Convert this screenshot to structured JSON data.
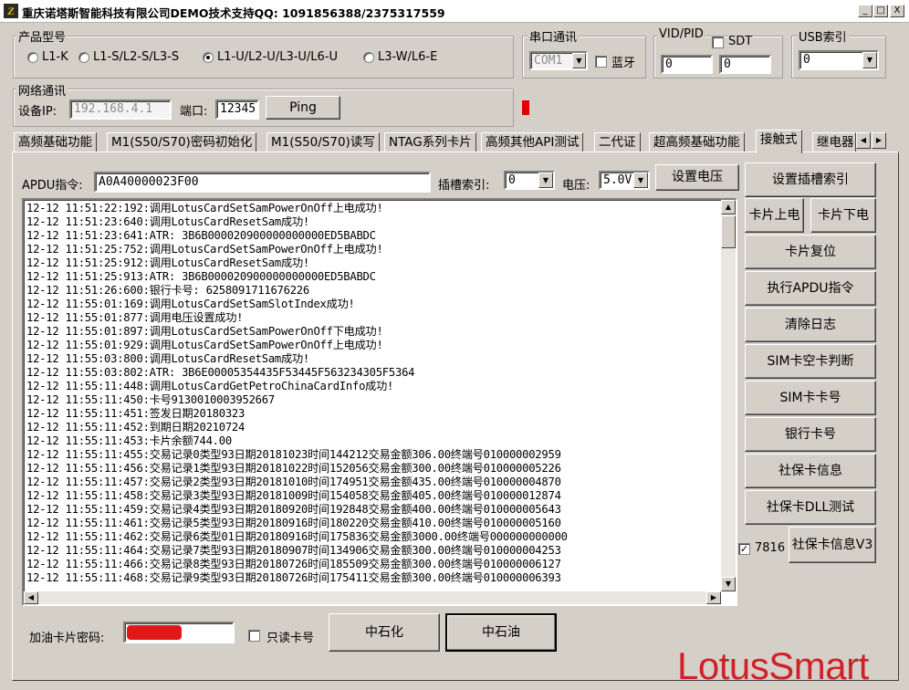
{
  "window": {
    "title": "重庆诺塔斯智能科技有限公司DEMO技术支持QQ: 1091856388/2375317559",
    "min": "_",
    "max": "□",
    "close": "X"
  },
  "product": {
    "group_label": "产品型号",
    "options": [
      "L1-K",
      "L1-S/L2-S/L3-S",
      "L1-U/L2-U/L3-U/L6-U",
      "L3-W/L6-E"
    ],
    "selected_index": 2
  },
  "serial": {
    "group_label": "串口通讯",
    "port": "COM1",
    "bluetooth_label": "蓝牙"
  },
  "vidpid": {
    "group_label": "VID/PID",
    "sdt_label": "SDT",
    "vid": "0",
    "pid": "0"
  },
  "usb": {
    "group_label": "USB索引",
    "value": "0"
  },
  "network": {
    "group_label": "网络通讯",
    "ip_label": "设备IP:",
    "ip": "192.168.4.1",
    "port_label": "端口:",
    "port": "12345",
    "ping_label": "Ping"
  },
  "tabs": [
    "高频基础功能",
    "M1(S50/S70)密码初始化",
    "M1(S50/S70)读写",
    "NTAG系列卡片",
    "高频其他API测试",
    "二代证",
    "超高频基础功能",
    "接触式",
    "继电器"
  ],
  "active_tab": "接触式",
  "apdu": {
    "label": "APDU指令:",
    "value": "A0A40000023F00",
    "slot_label": "插槽索引:",
    "slot": "0",
    "voltage_label": "电压:",
    "voltage": "5.0V",
    "set_voltage": "设置电压"
  },
  "log": [
    "12-12 11:51:22:192:调用LotusCardSetSamPowerOnOff上电成功!",
    "12-12 11:51:23:640:调用LotusCardResetSam成功!",
    "12-12 11:51:23:641:ATR: 3B6B000020900000000000ED5BABDC",
    "12-12 11:51:25:752:调用LotusCardSetSamPowerOnOff上电成功!",
    "12-12 11:51:25:912:调用LotusCardResetSam成功!",
    "12-12 11:51:25:913:ATR: 3B6B000020900000000000ED5BABDC",
    "12-12 11:51:26:600:银行卡号: 6258091711676226",
    "12-12 11:55:01:169:调用LotusCardSetSamSlotIndex成功!",
    "12-12 11:55:01:877:调用电压设置成功!",
    "12-12 11:55:01:897:调用LotusCardSetSamPowerOnOff下电成功!",
    "12-12 11:55:01:929:调用LotusCardSetSamPowerOnOff上电成功!",
    "12-12 11:55:03:800:调用LotusCardResetSam成功!",
    "12-12 11:55:03:802:ATR: 3B6E00005354435F53445F563234305F5364",
    "12-12 11:55:11:448:调用LotusCardGetPetroChinaCardInfo成功!",
    "12-12 11:55:11:450:卡号9130010003952667",
    "12-12 11:55:11:451:签发日期20180323",
    "12-12 11:55:11:452:到期日期20210724",
    "12-12 11:55:11:453:卡片余额744.00",
    "12-12 11:55:11:455:交易记录0类型93日期20181023时间144212交易金额306.00终端号010000002959",
    "12-12 11:55:11:456:交易记录1类型93日期20181022时间152056交易金额300.00终端号010000005226",
    "12-12 11:55:11:457:交易记录2类型93日期20181010时间174951交易金额435.00终端号010000004870",
    "12-12 11:55:11:458:交易记录3类型93日期20181009时间154058交易金额405.00终端号010000012874",
    "12-12 11:55:11:459:交易记录4类型93日期20180920时间192848交易金额400.00终端号010000005643",
    "12-12 11:55:11:461:交易记录5类型93日期20180916时间180220交易金额410.00终端号010000005160",
    "12-12 11:55:11:462:交易记录6类型01日期20180916时间175836交易金额3000.00终端号000000000000",
    "12-12 11:55:11:464:交易记录7类型93日期20180907时间134906交易金额300.00终端号010000004253",
    "12-12 11:55:11:466:交易记录8类型93日期20180726时间185509交易金额300.00终端号010000006127",
    "12-12 11:55:11:468:交易记录9类型93日期20180726时间175411交易金额300.00终端号010000006393"
  ],
  "right_buttons": {
    "set_slot": "设置插槽索引",
    "card_on": "卡片上电",
    "card_off": "卡片下电",
    "card_reset": "卡片复位",
    "exec_apdu": "执行APDU指令",
    "clear_log": "清除日志",
    "sim_blank": "SIM卡空卡判断",
    "sim_number": "SIM卡卡号",
    "bank_number": "银行卡号",
    "social_info": "社保卡信息",
    "social_dll": "社保卡DLL测试",
    "social_v3": "社保卡信息V3",
    "check_value": "7816"
  },
  "bottom": {
    "pwd_label": "加油卡片密码:",
    "readonly_label": "只读卡号",
    "sinopec": "中石化",
    "petrochina": "中石油"
  },
  "brand": "LotusSmart",
  "colors": {
    "face": "#d4d0c8",
    "brand_red": "#d0202a",
    "led": "#e00000"
  }
}
